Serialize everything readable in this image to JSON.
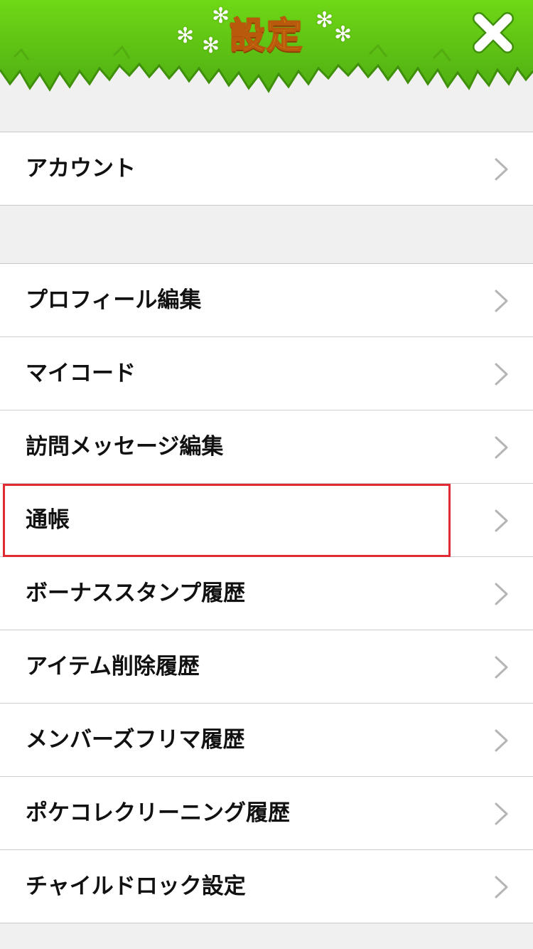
{
  "header": {
    "title": "設定",
    "close_icon": "close-x-icon",
    "colors": {
      "grass": "#5cc414",
      "title_fill": "#ffc21e",
      "title_outline": "#b8590c"
    }
  },
  "account_group": {
    "items": [
      {
        "label": "アカウント",
        "icon": "chevron-right-icon"
      }
    ]
  },
  "main_group": {
    "items": [
      {
        "label": "プロフィール編集",
        "icon": "chevron-right-icon"
      },
      {
        "label": "マイコード",
        "icon": "chevron-right-icon"
      },
      {
        "label": "訪問メッセージ編集",
        "icon": "chevron-right-icon"
      },
      {
        "label": "通帳",
        "icon": "chevron-right-icon"
      },
      {
        "label": "ボーナススタンプ履歴",
        "icon": "chevron-right-icon"
      },
      {
        "label": "アイテム削除履歴",
        "icon": "chevron-right-icon"
      },
      {
        "label": "メンバーズフリマ履歴",
        "icon": "chevron-right-icon"
      },
      {
        "label": "ポケコレクリーニング履歴",
        "icon": "chevron-right-icon"
      },
      {
        "label": "チャイルドロック設定",
        "icon": "chevron-right-icon"
      }
    ]
  },
  "highlight": {
    "target": "通帳",
    "color": "#e02a34"
  }
}
